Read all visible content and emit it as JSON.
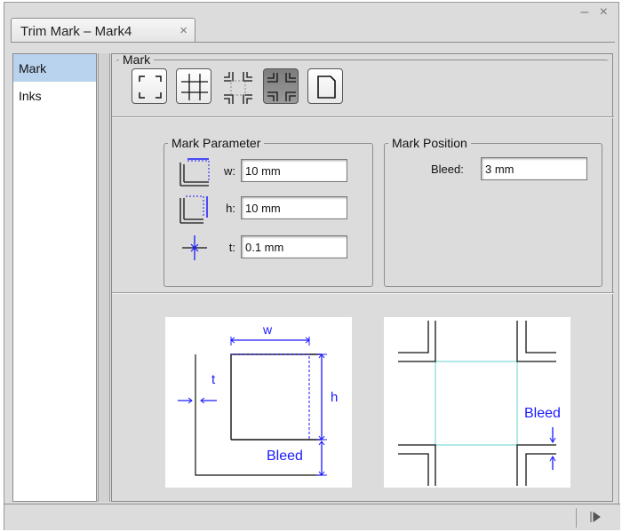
{
  "window": {
    "tab_title": "Trim Mark – Mark4",
    "tab_close": "×",
    "controls": "– ×"
  },
  "sidebar": {
    "items": [
      {
        "label": "Mark",
        "active": true
      },
      {
        "label": "Inks",
        "active": false
      }
    ]
  },
  "mark_group": {
    "legend": "Mark",
    "buttons": [
      {
        "icon": "corner-marks-icon",
        "selected": false
      },
      {
        "icon": "cross-marks-icon",
        "selected": false
      },
      {
        "icon": "double-corner-marks-icon",
        "selected": false
      },
      {
        "icon": "bleed-corner-marks-icon",
        "selected": true
      },
      {
        "icon": "page-corner-icon",
        "selected": false
      }
    ]
  },
  "mark_parameter": {
    "legend": "Mark Parameter",
    "w_label": "w:",
    "w_value": "10 mm",
    "h_label": "h:",
    "h_value": "10 mm",
    "t_label": "t:",
    "t_value": "0.1 mm"
  },
  "mark_position": {
    "legend": "Mark Position",
    "bleed_label": "Bleed:",
    "bleed_value": "3 mm"
  },
  "diagram_left": {
    "w": "w",
    "h": "h",
    "t": "t",
    "bleed": "Bleed"
  },
  "diagram_right": {
    "bleed": "Bleed"
  },
  "colors": {
    "accent_blue": "#1a1aff",
    "bleed_cyan": "#7fd9d9",
    "selection": "#b9d3ee"
  }
}
